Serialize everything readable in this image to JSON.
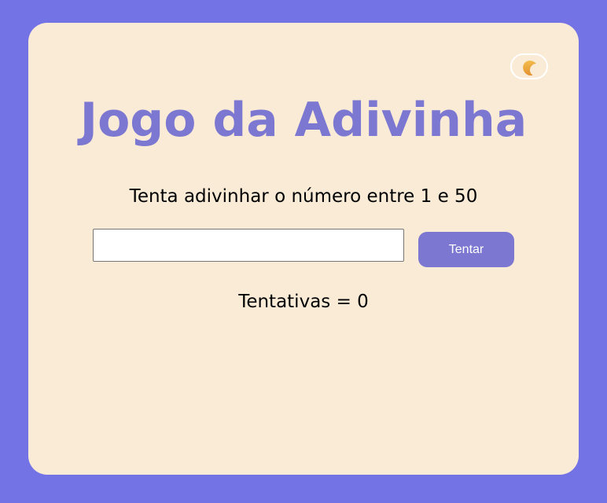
{
  "page": {
    "background_color": "#7373e6",
    "card_color": "#faebd7",
    "accent_color": "#7c78d1"
  },
  "theme_toggle": {
    "icon": "crescent-moon-icon"
  },
  "game": {
    "title": "Jogo da Adivinha",
    "instruction": "Tenta adivinhar o número entre 1 e 50",
    "guess_input_value": "",
    "guess_input_placeholder": "",
    "try_button_label": "Tentar",
    "attempts_label": "Tentativas = 0"
  }
}
